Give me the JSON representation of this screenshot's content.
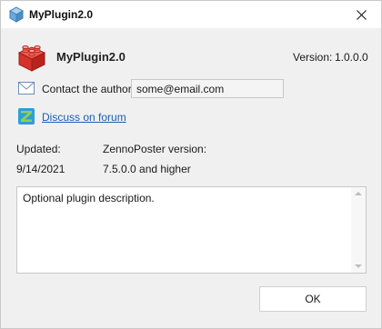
{
  "window": {
    "title": "MyPlugin2.0"
  },
  "plugin": {
    "name": "MyPlugin2.0",
    "version_label": "Version:",
    "version": "1.0.0.0"
  },
  "contact": {
    "label": "Contact the author:",
    "email": "some@email.com"
  },
  "forum": {
    "link_text": "Discuss on forum"
  },
  "info": {
    "updated_label": "Updated:",
    "updated_value": "9/14/2021",
    "zennoposter_label": "ZennoPoster version:",
    "zennoposter_value": "7.5.0.0 and higher"
  },
  "description": {
    "text": "Optional plugin description."
  },
  "buttons": {
    "ok_label": "OK"
  },
  "colors": {
    "link": "#1a5fb4",
    "logo_red": "#d9332b",
    "window_bg": "#f0f0f0",
    "titlebar_bg": "#ffffff"
  },
  "icons": {
    "title": "cube-icon",
    "logo": "plugin-brick-logo",
    "mail": "envelope-icon",
    "forum": "zennolab-forum-icon",
    "close": "close-icon"
  }
}
